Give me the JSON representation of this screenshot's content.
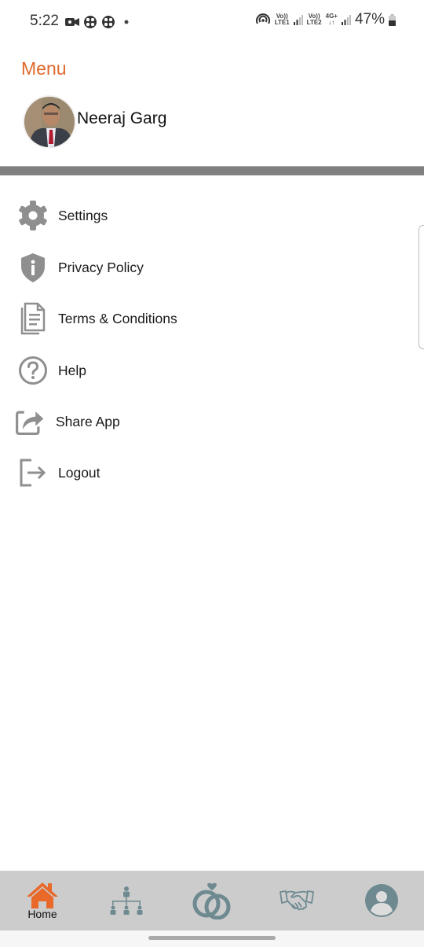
{
  "status_bar": {
    "time": "5:22",
    "left_icons": [
      "video-camera-icon",
      "app-notification-icon",
      "app-notification-icon",
      "more-notifications-dot"
    ],
    "hotspot_icon": "hotspot-icon",
    "sim1": {
      "top": "Vo))",
      "bottom": "LTE1"
    },
    "sim2": {
      "top": "Vo))",
      "bottom": "LTE2"
    },
    "network": {
      "top": "4G+",
      "bottom": "↓↑"
    },
    "battery_percent": "47%"
  },
  "header": {
    "title": "Menu",
    "user_name": "Neeraj Garg"
  },
  "menu": {
    "items": [
      {
        "label": "Settings",
        "icon": "gear-icon"
      },
      {
        "label": "Privacy Policy",
        "icon": "shield-info-icon"
      },
      {
        "label": "Terms & Conditions",
        "icon": "document-icon"
      },
      {
        "label": "Help",
        "icon": "help-circle-icon"
      },
      {
        "label": "Share App",
        "icon": "share-icon"
      },
      {
        "label": "Logout",
        "icon": "logout-icon"
      }
    ]
  },
  "bottom_nav": {
    "items": [
      {
        "label": "Home",
        "icon": "home-icon",
        "active": true
      },
      {
        "label": "",
        "icon": "hierarchy-icon",
        "active": false
      },
      {
        "label": "",
        "icon": "rings-icon",
        "active": false
      },
      {
        "label": "",
        "icon": "handshake-icon",
        "active": false
      },
      {
        "label": "",
        "icon": "profile-icon",
        "active": false
      }
    ]
  },
  "colors": {
    "accent": "#e0692e",
    "icon_gray": "#8f8f8f",
    "nav_icon": "#6e8a90",
    "nav_bg": "#cccccc",
    "divider": "#808080"
  }
}
